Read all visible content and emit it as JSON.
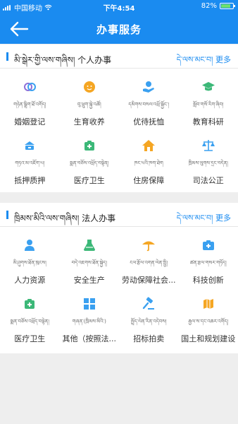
{
  "status": {
    "carrier": "中国移动",
    "time": "下午4:54",
    "battery": "82%",
    "battery_level": 0.82
  },
  "header": {
    "title": "办事服务"
  },
  "colors": {
    "primary": "#1a8bf0",
    "icon_blue": "#3aa0f0",
    "icon_orange": "#f5a623",
    "icon_green": "#3cb878",
    "icon_purple": "#8e6fd8"
  },
  "personal": {
    "title": "མི་སྒེར་གྱི་ལས་གཞིས། 个人办事",
    "more": "དེ་ལས་མང་བ། 更多",
    "items": [
      {
        "tib": "གཉེན་སྒྲིག་ཐོ་འགོད།",
        "label": "婚姻登记",
        "icon": "marriage-icon"
      },
      {
        "tib": "བུ་ཕྲུག་སྐྱེ་འཚོ།",
        "label": "生育收养",
        "icon": "childbirth-icon"
      },
      {
        "tib": "དམིགས་བསལ་འཕྲོ་སྐྱོང་།",
        "label": "优待抚恤",
        "icon": "preferential-care-icon"
      },
      {
        "tib": "སློབ་གསོ་རིག་ཞིབ།",
        "label": "教育科研",
        "icon": "education-icon"
      },
      {
        "tib": "གཏའ་མ་འཇོག་པ།",
        "label": "抵押质押",
        "icon": "mortgage-icon"
      },
      {
        "tib": "སྨན་བཅོས་འཕྲོད་བསྟེན།",
        "label": "医疗卫生",
        "icon": "medical-icon"
      },
      {
        "tib": "ཁང་པའི་ཁག་ཐེག",
        "label": "住房保障",
        "icon": "housing-icon"
      },
      {
        "tib": "ཁྲིམས་ལུགས་དྲང་བདེན།",
        "label": "司法公正",
        "icon": "justice-icon"
      }
    ]
  },
  "legal": {
    "title": "ཁྲིམས་མིའི་ལས་གཞིས། 法人办事",
    "more": "དེ་ལས་མང་བ། 更多",
    "items": [
      {
        "tib": "མི་ཤུགས་ཐོན་ཁུངས།",
        "label": "人力资源",
        "icon": "hr-icon"
      },
      {
        "tib": "བདེ་འཇགས་ཐོན་སྐྱེད།",
        "label": "安全生产",
        "icon": "safety-icon"
      },
      {
        "tib": "ངལ་རྩོལ་འགན་ལེན་སྤྱི།",
        "label": "劳动保障社会...",
        "icon": "labor-icon"
      },
      {
        "tib": "ཚན་རྩལ་གསར་གཏོད།",
        "label": "科技创新",
        "icon": "tech-icon"
      },
      {
        "tib": "སྨན་བཅོས་འཕྲོད་བསྟེན།",
        "label": "医疗卫生",
        "icon": "medical-icon"
      },
      {
        "tib": "གཞན་(ཁྲིམས་མིའི་)",
        "label": "其他（按照法...",
        "icon": "other-icon"
      },
      {
        "tib": "སྤྲོད་ལེན་རིན་འདེབས།",
        "label": "招标拍卖",
        "icon": "auction-icon"
      },
      {
        "tib": "རྒྱལ་ས་དང་འཆར་འགོད།",
        "label": "国土和规划建设",
        "icon": "land-planning-icon"
      }
    ]
  }
}
